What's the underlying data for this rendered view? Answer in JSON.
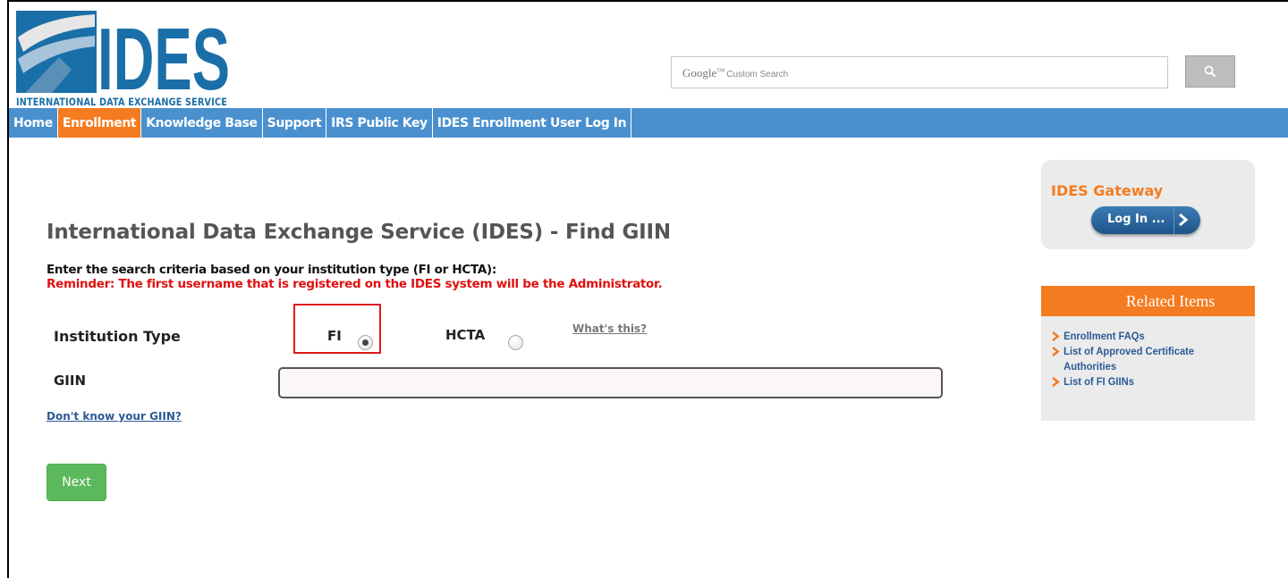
{
  "logo": {
    "main_text": "IDES",
    "sub_text": "INTERNATIONAL DATA EXCHANGE SERVICE"
  },
  "search": {
    "google_brand": "Google",
    "google_tm": "TM",
    "custom_label": "Custom Search",
    "button_icon": "search-icon"
  },
  "nav": {
    "items": [
      {
        "label": "Home",
        "active": false
      },
      {
        "label": "Enrollment",
        "active": true
      },
      {
        "label": "Knowledge Base",
        "active": false
      },
      {
        "label": "Support",
        "active": false
      },
      {
        "label": "IRS Public Key",
        "active": false
      },
      {
        "label": "IDES Enrollment User Log In",
        "active": false
      }
    ]
  },
  "main": {
    "title": "International Data Exchange Service (IDES) - Find GIIN",
    "instruction": "Enter the search criteria based on your institution type (FI or HCTA):",
    "reminder": "Reminder: The first username that is registered on the IDES system will be the Administrator.",
    "institution_type_label": "Institution Type",
    "option_fi": "FI",
    "option_hcta": "HCTA",
    "selected_option": "FI",
    "whats_this": "What's this?",
    "giin_label": "GIIN",
    "giin_value": "",
    "dont_know": "Don't know your GIIN?",
    "next_label": "Next"
  },
  "sidebar": {
    "gateway_title": "IDES Gateway",
    "login_label": "Log In ...",
    "related_title": "Related Items",
    "related_items": [
      "Enrollment FAQs",
      "List of Approved Certificate Authorities",
      "List of FI GIINs"
    ]
  },
  "colors": {
    "nav_blue": "#4a90cf",
    "accent_orange": "#f47b20",
    "next_green": "#5cb85c",
    "reminder_red": "#e01010",
    "link_blue": "#2b5a96"
  }
}
